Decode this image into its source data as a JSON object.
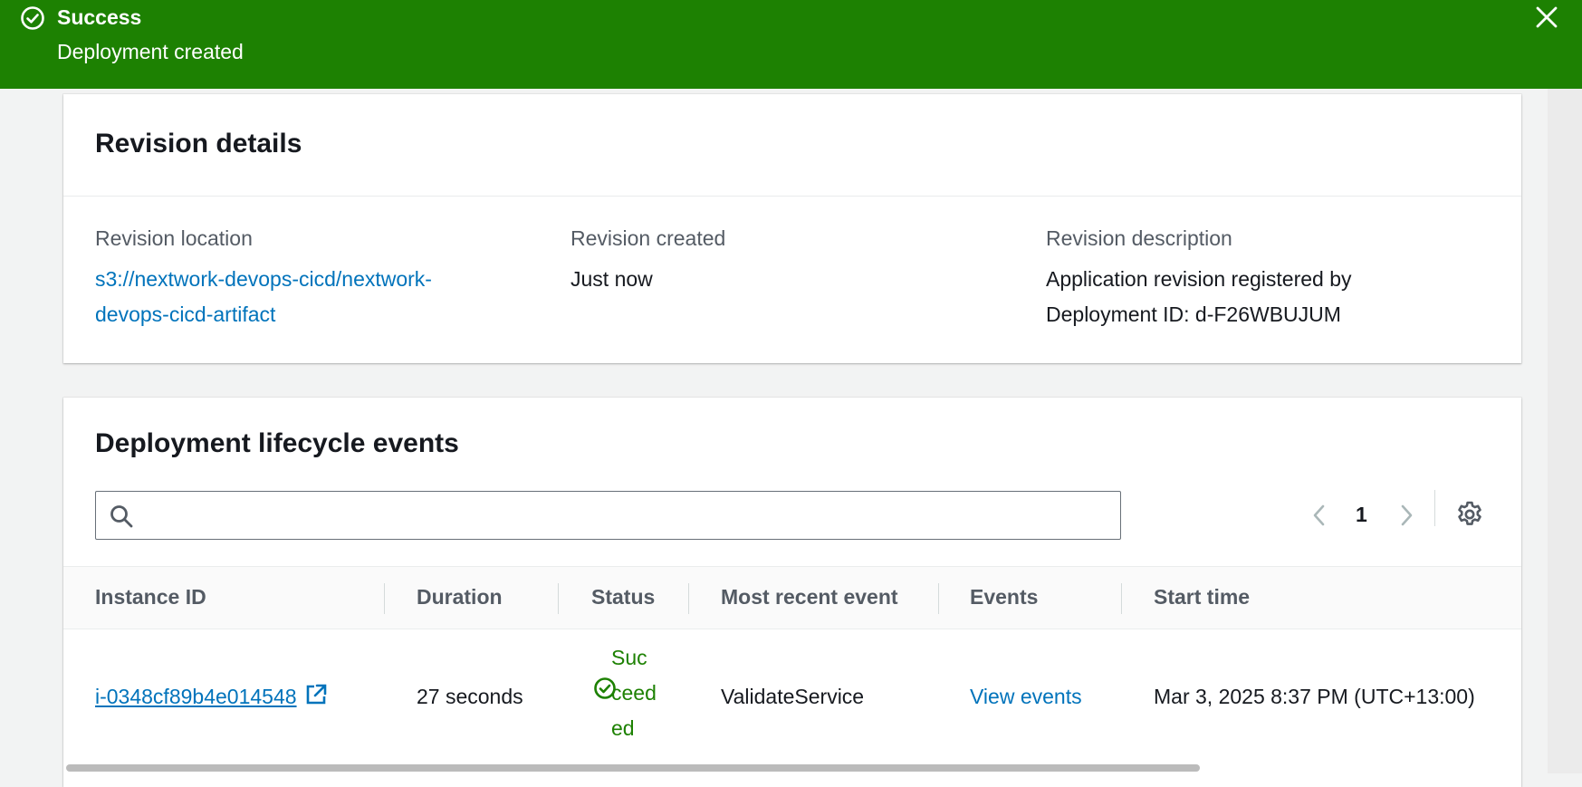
{
  "flash": {
    "title": "Success",
    "message": "Deployment created"
  },
  "revision_details": {
    "title": "Revision details",
    "location_label": "Revision location",
    "location_value_line1": "s3://nextwork-devops-cicd/nextwork-",
    "location_value_line2": "devops-cicd-artifact",
    "created_label": "Revision created",
    "created_value": "Just now",
    "description_label": "Revision description",
    "description_line1": "Application revision registered by",
    "description_line2": "Deployment ID: d-F26WBUJUM"
  },
  "lifecycle": {
    "title": "Deployment lifecycle events",
    "search": {
      "placeholder": "",
      "value": ""
    },
    "pagination": {
      "current_page": "1"
    },
    "columns": [
      "Instance ID",
      "Duration",
      "Status",
      "Most recent event",
      "Events",
      "Start time"
    ],
    "rows": [
      {
        "instance_id": "i-0348cf89b4e014548",
        "duration": "27 seconds",
        "status": "Succeeded",
        "most_recent_event": "ValidateService",
        "events_link": "View events",
        "start_time": "Mar 3, 2025 8:37 PM (UTC+13:00)"
      }
    ]
  },
  "colors": {
    "success": "#1d8102",
    "link": "#0073bb",
    "heading": "#16191f",
    "label": "#545b64"
  },
  "icons": [
    "check-circle-icon",
    "close-icon",
    "search-icon",
    "chevron-left-icon",
    "chevron-right-icon",
    "gear-icon",
    "external-link-icon",
    "status-success-icon"
  ]
}
